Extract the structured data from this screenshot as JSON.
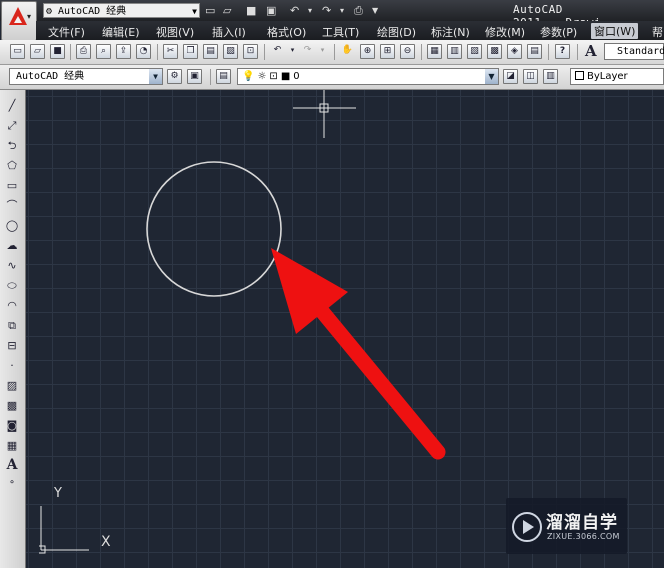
{
  "titlebar": {
    "app_title": "AutoCAD 2011",
    "doc_title": "Drawi",
    "workspace": "AutoCAD 经典"
  },
  "menu": {
    "items": [
      {
        "label": "文件(F)"
      },
      {
        "label": "编辑(E)"
      },
      {
        "label": "视图(V)"
      },
      {
        "label": "插入(I)"
      },
      {
        "label": "格式(O)"
      },
      {
        "label": "工具(T)"
      },
      {
        "label": "绘图(D)"
      },
      {
        "label": "标注(N)"
      },
      {
        "label": "修改(M)"
      },
      {
        "label": "参数(P)"
      },
      {
        "label": "窗口(W)"
      },
      {
        "label": "帮"
      }
    ]
  },
  "toolbar": {
    "text_style": "Standard",
    "help_glyph": "?"
  },
  "layers": {
    "workspace": "AutoCAD 经典",
    "current_layer": "0",
    "color": "ByLayer"
  },
  "ucs": {
    "x_label": "X",
    "y_label": "Y"
  },
  "watermark": {
    "name": "溜溜自学",
    "url": "ZIXUE.3066.COM"
  },
  "colors": {
    "canvas_bg": "#1f2633",
    "grid": "#2d3645",
    "circle_stroke": "#d8d8d8",
    "arrow": "#ee1111"
  }
}
